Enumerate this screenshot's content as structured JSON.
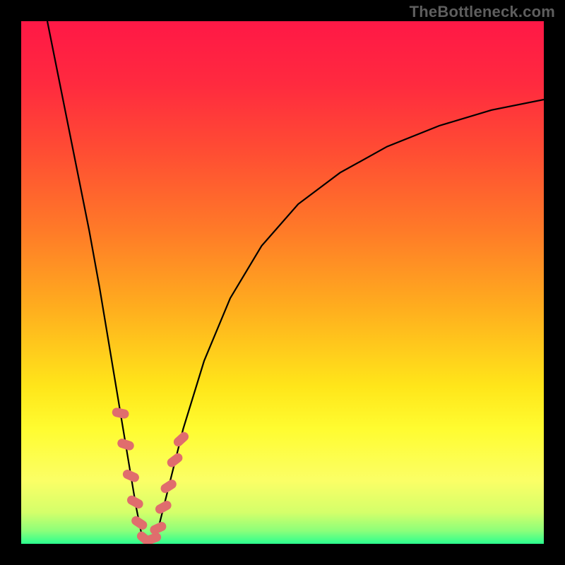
{
  "attribution": "TheBottleneck.com",
  "colors": {
    "frame": "#000000",
    "attribution_text": "#5e5e5e",
    "curve_stroke": "#000000",
    "marker_fill": "#e06d6d",
    "gradient_stops": [
      {
        "offset": 0.0,
        "color": "#ff1846"
      },
      {
        "offset": 0.12,
        "color": "#ff2a3f"
      },
      {
        "offset": 0.25,
        "color": "#ff4d33"
      },
      {
        "offset": 0.4,
        "color": "#ff7a28"
      },
      {
        "offset": 0.55,
        "color": "#ffae1e"
      },
      {
        "offset": 0.7,
        "color": "#ffe61a"
      },
      {
        "offset": 0.78,
        "color": "#fffc30"
      },
      {
        "offset": 0.88,
        "color": "#fbff66"
      },
      {
        "offset": 0.94,
        "color": "#d4ff6a"
      },
      {
        "offset": 0.975,
        "color": "#8cff7a"
      },
      {
        "offset": 1.0,
        "color": "#2bff8f"
      }
    ]
  },
  "chart_data": {
    "type": "line",
    "title": "",
    "xlabel": "",
    "ylabel": "",
    "xlim": [
      0,
      100
    ],
    "ylim": [
      0,
      100
    ],
    "grid": false,
    "legend": false,
    "note": "Axes are unlabeled; values are read off relative position (percent of plot area). y is the height of the curve above the bottom edge.",
    "series": [
      {
        "name": "left-branch",
        "x": [
          5,
          7,
          9,
          11,
          13,
          15,
          17,
          18,
          19,
          20,
          21,
          22,
          23
        ],
        "y": [
          100,
          90,
          80,
          70,
          60,
          49,
          37,
          31,
          25,
          19,
          13,
          7,
          2
        ]
      },
      {
        "name": "valley",
        "x": [
          23,
          24,
          25,
          26
        ],
        "y": [
          2,
          0.5,
          0.5,
          2
        ]
      },
      {
        "name": "right-branch",
        "x": [
          26,
          28,
          31,
          35,
          40,
          46,
          53,
          61,
          70,
          80,
          90,
          100
        ],
        "y": [
          2,
          10,
          22,
          35,
          47,
          57,
          65,
          71,
          76,
          80,
          83,
          85
        ]
      }
    ],
    "markers": {
      "name": "highlighted-points",
      "note": "Salmon capsule markers clustered near the valley on both branches.",
      "points": [
        {
          "x": 19.0,
          "y": 25
        },
        {
          "x": 20.0,
          "y": 19
        },
        {
          "x": 21.0,
          "y": 13
        },
        {
          "x": 21.8,
          "y": 8
        },
        {
          "x": 22.6,
          "y": 4
        },
        {
          "x": 23.6,
          "y": 1
        },
        {
          "x": 25.2,
          "y": 1
        },
        {
          "x": 26.2,
          "y": 3
        },
        {
          "x": 27.2,
          "y": 7
        },
        {
          "x": 28.2,
          "y": 11
        },
        {
          "x": 29.4,
          "y": 16
        },
        {
          "x": 30.6,
          "y": 20
        }
      ]
    }
  }
}
